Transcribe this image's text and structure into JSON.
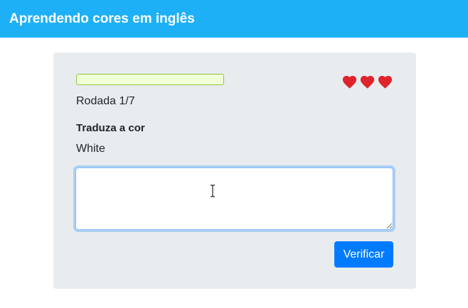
{
  "header": {
    "title": "Aprendendo cores em inglês"
  },
  "game": {
    "progress_fraction": 0.0,
    "lives": 3,
    "heart_icon": "heart-icon",
    "round_label": "Rodada 1/7",
    "prompt_label": "Traduza a cor",
    "word": "White",
    "answer_value": "",
    "verify_label": "Verificar"
  },
  "colors": {
    "navbar": "#1eb0f6",
    "card": "#e9ecef",
    "progress_border": "#8cc63f",
    "progress_bg": "#f1ffd6",
    "heart": "#e0242b",
    "button": "#007bff"
  }
}
